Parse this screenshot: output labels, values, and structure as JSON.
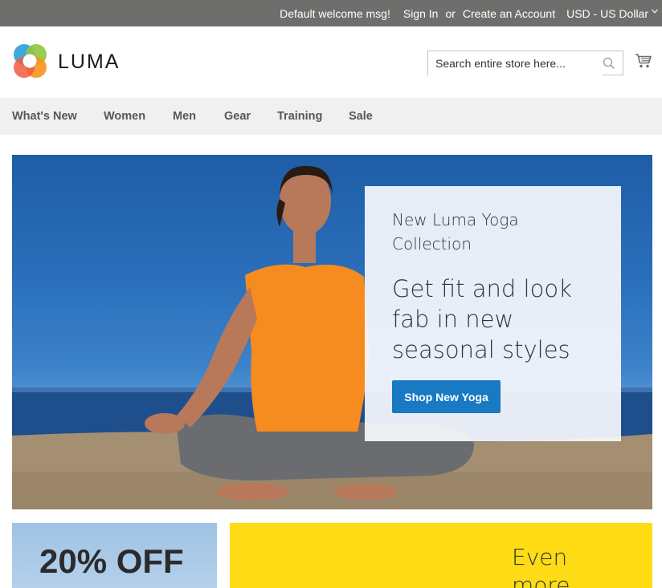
{
  "top_panel": {
    "welcome": "Default welcome msg!",
    "sign_in": "Sign In",
    "or": "or",
    "create_account": "Create an Account",
    "currency": "USD - US Dollar"
  },
  "header": {
    "logo_text": "LUMA",
    "search_placeholder": "Search entire store here...",
    "icons": [
      "luma-logo-icon",
      "search-icon",
      "cart-icon",
      "chevron-down-icon"
    ]
  },
  "nav": {
    "items": [
      {
        "label": "What's New"
      },
      {
        "label": "Women"
      },
      {
        "label": "Men"
      },
      {
        "label": "Gear"
      },
      {
        "label": "Training"
      },
      {
        "label": "Sale"
      }
    ]
  },
  "hero": {
    "subtitle": "New Luma Yoga Collection",
    "title": "Get fit and look fab in new seasonal styles",
    "button_label": "Shop New Yoga"
  },
  "tiles": {
    "left_text": "20% OFF",
    "right_text": "Even more"
  },
  "colors": {
    "top_panel_bg": "#6e6e6c",
    "nav_bg": "#f0f0f0",
    "primary_button": "#1979c3",
    "yellow_tile": "#fedc15"
  }
}
